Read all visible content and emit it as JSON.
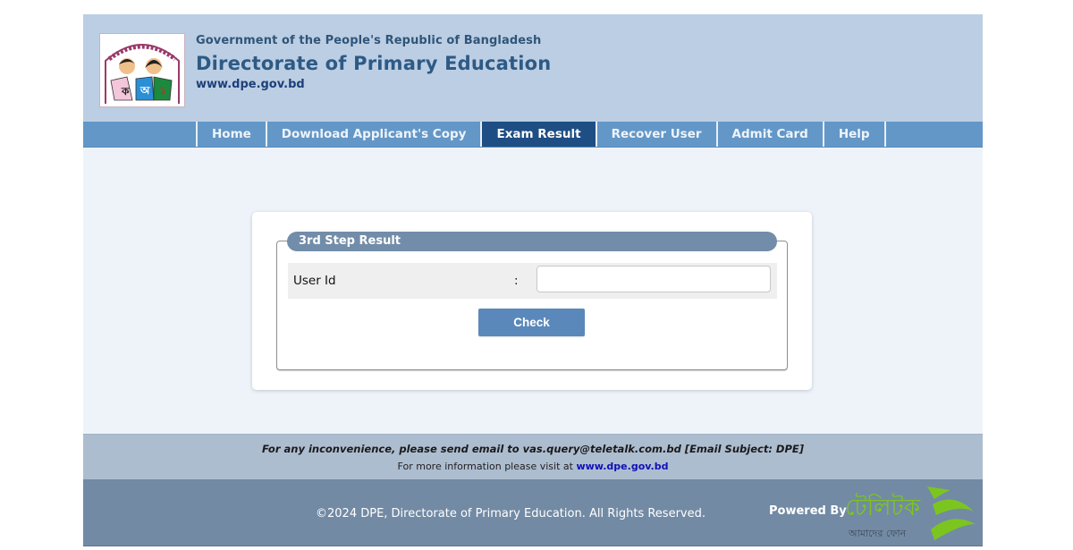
{
  "header": {
    "government_line": "Government of the People's Republic of Bangladesh",
    "title": "Directorate of Primary Education",
    "url": "www.dpe.gov.bd"
  },
  "nav": {
    "items": [
      {
        "label": "Home",
        "active": false
      },
      {
        "label": "Download Applicant's Copy",
        "active": false
      },
      {
        "label": "Exam Result",
        "active": true
      },
      {
        "label": "Recover User",
        "active": false
      },
      {
        "label": "Admit Card",
        "active": false
      },
      {
        "label": "Help",
        "active": false
      }
    ]
  },
  "form": {
    "legend": "3rd Step Result",
    "user_id_label": "User Id",
    "separator": ":",
    "user_id_value": "",
    "submit_label": "Check"
  },
  "footer": {
    "note": "For any inconvenience, please send email to vas.query@teletalk.com.bd [Email Subject: DPE]",
    "more_info_prefix": "For more information please visit at",
    "more_info_link": "www.dpe.gov.bd",
    "copyright": "©2024 DPE, Directorate of Primary Education. All Rights Reserved.",
    "powered_by": "Powered By",
    "teletalk_name": "টেলিটক",
    "teletalk_tagline": "আমাদের ফোন"
  },
  "colors": {
    "header_bg": "#bccee3",
    "nav_bg": "#6397c7",
    "nav_active": "#1e4e84",
    "legend_bg": "#728da9",
    "button_bg": "#5a88ba",
    "footer_info_bg": "#adbdd0",
    "footer_bottom_bg": "#728aa4",
    "teletalk_green": "#7cc520"
  }
}
